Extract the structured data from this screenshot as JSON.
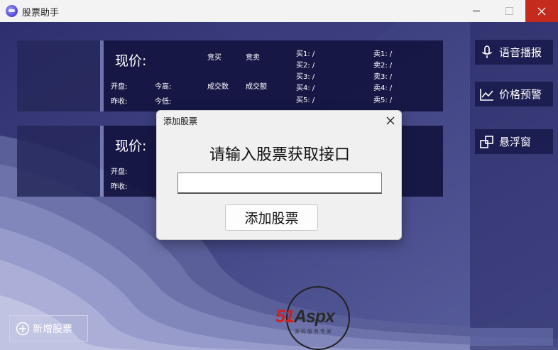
{
  "window": {
    "title": "股票助手"
  },
  "cards": [
    {
      "price_label": "现价:",
      "open_label": "开盘:",
      "prev_close_label": "昨收:",
      "today_high_label": "今高:",
      "today_low_label": "今低:",
      "bid_label": "竞买",
      "ask_label": "竞卖",
      "volume_label": "成交数",
      "amount_label": "成交额",
      "buys": [
        "买1: /",
        "买2: /",
        "买3: /",
        "买4: /",
        "买5: /"
      ],
      "sells": [
        "卖1: /",
        "卖2: /",
        "卖3: /",
        "卖4: /",
        "卖5: /"
      ]
    },
    {
      "price_label": "现价:",
      "open_label": "开盘:",
      "prev_close_label": "昨收:"
    }
  ],
  "sidebar": {
    "voice": "语音播报",
    "alert": "价格预警",
    "float": "悬浮窗"
  },
  "add_stock_button": "新增股票",
  "watermark": {
    "brand_a": "51",
    "brand_b": "Aspx",
    "tagline": "源码服务专家"
  },
  "dialog": {
    "title": "添加股票",
    "prompt": "请输入股票获取接口",
    "input_value": "",
    "submit": "添加股票"
  },
  "colors": {
    "close_red": "#c42b1c",
    "card_bg": "#141442",
    "accent_red": "#d02020"
  }
}
